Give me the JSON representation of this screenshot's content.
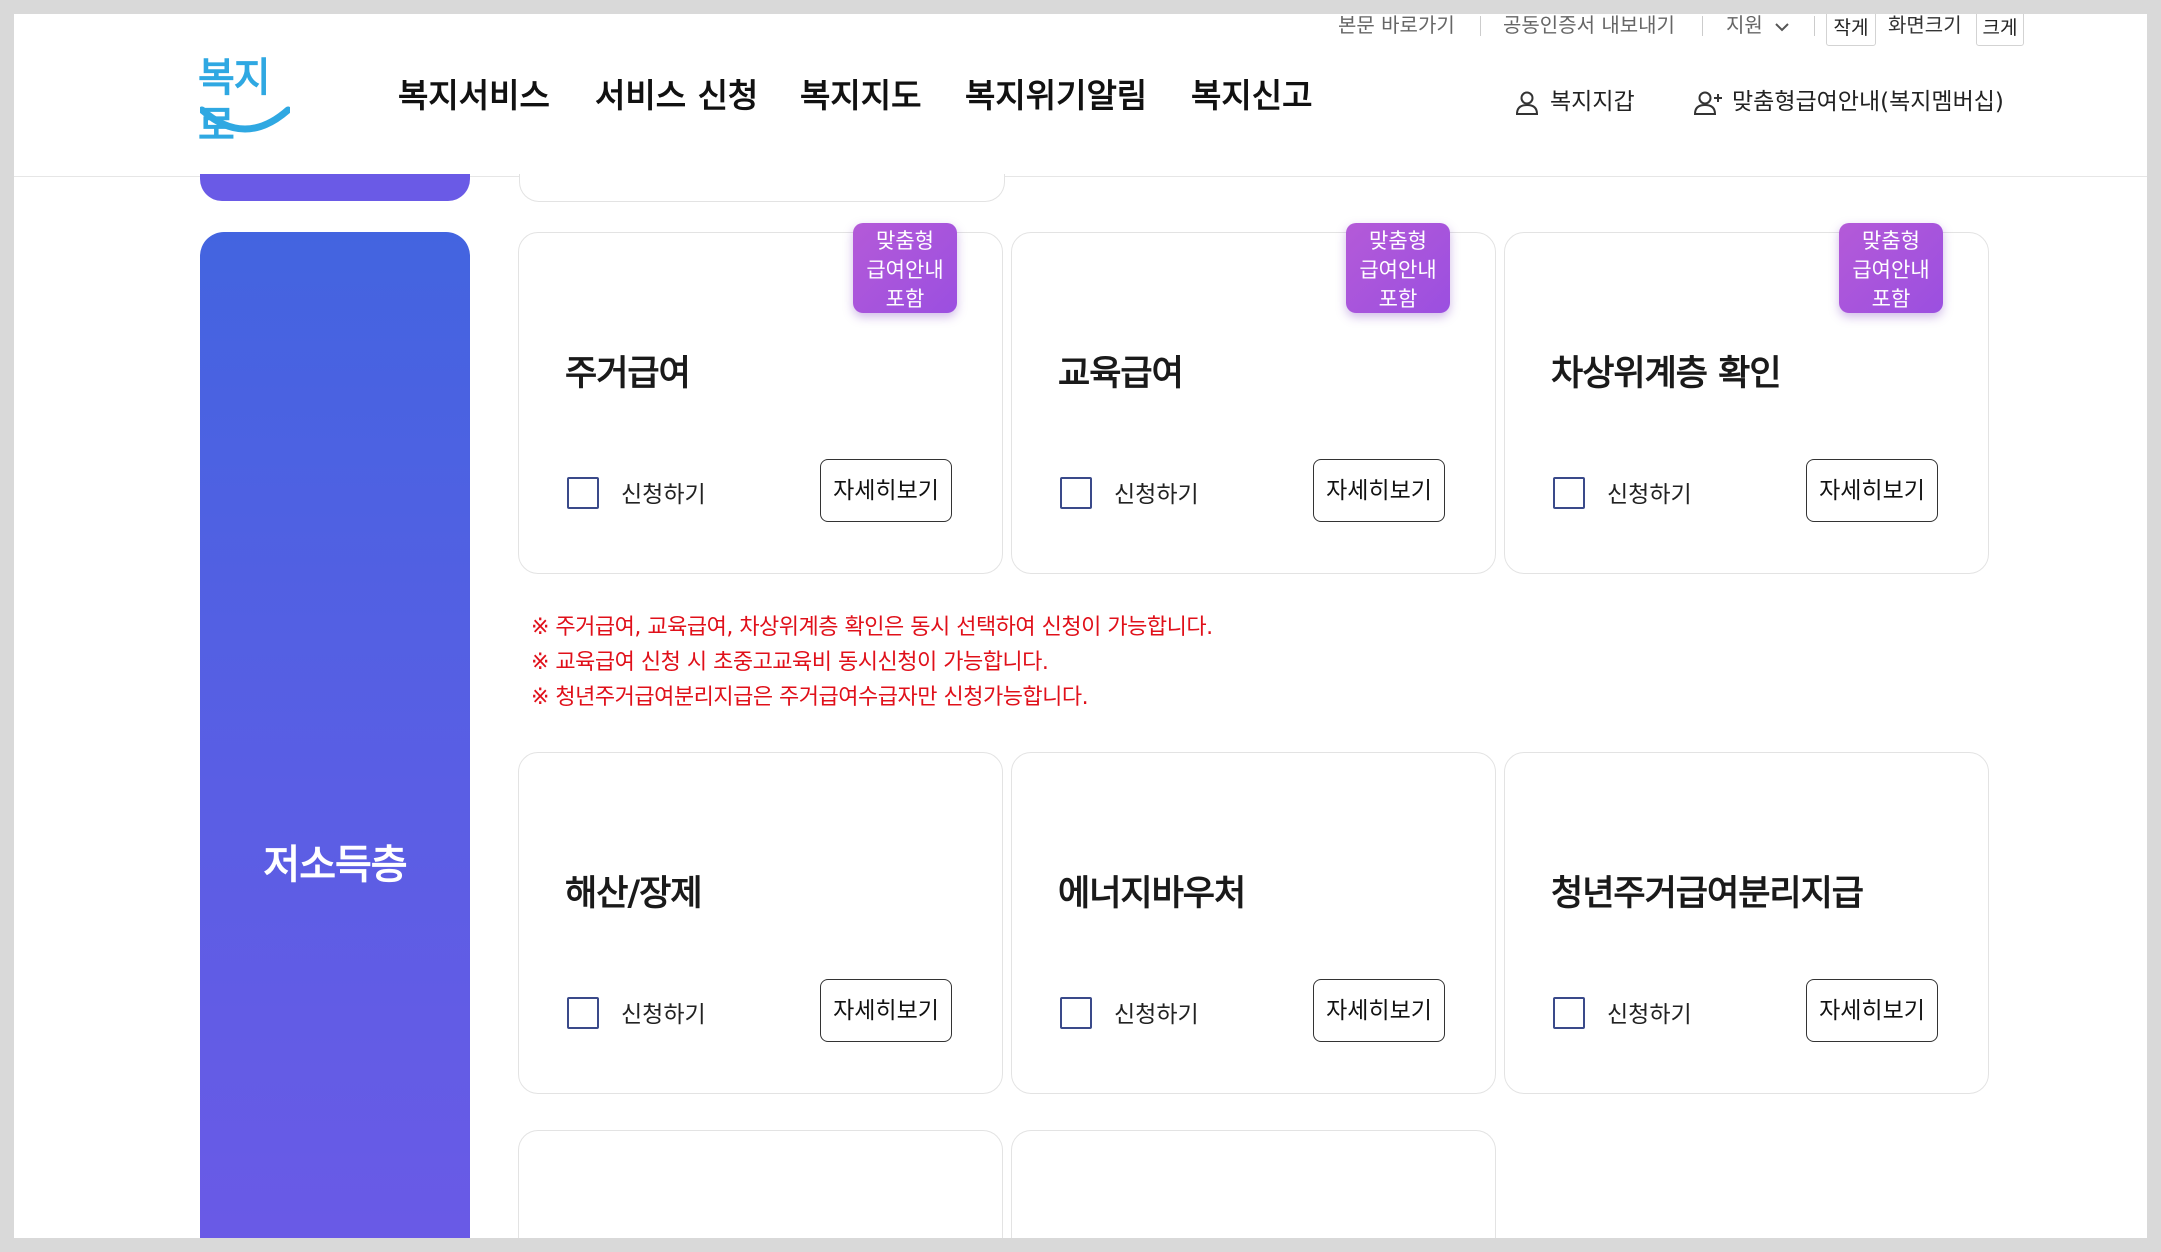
{
  "utility": {
    "skip_link": "본문 바로가기",
    "cert_export": "공동인증서 내보내기",
    "support": "지원",
    "font_small": "작게",
    "font_size_label": "화면크기",
    "font_large": "크게"
  },
  "logo": {
    "text": "복지로"
  },
  "gnb": {
    "items": [
      "복지서비스",
      "서비스 신청",
      "복지지도",
      "복지위기알림",
      "복지신고"
    ]
  },
  "member": {
    "wallet": "복지지갑",
    "membership": "맞춤형급여안내(복지멤버십)"
  },
  "category": {
    "title": "저소득층"
  },
  "badge": {
    "line1": "맞춤형",
    "line2": "급여안내",
    "line3": "포함"
  },
  "common": {
    "apply_label": "신청하기",
    "detail_label": "자세히보기"
  },
  "cards_row1": [
    {
      "title": "주거급여",
      "badge": true
    },
    {
      "title": "교육급여",
      "badge": true
    },
    {
      "title": "차상위계층 확인",
      "badge": true
    }
  ],
  "notices": [
    "※ 주거급여, 교육급여, 차상위계층 확인은 동시 선택하여 신청이 가능합니다.",
    "※ 교육급여 신청 시 초중고교육비 동시신청이 가능합니다.",
    "※ 청년주거급여분리지급은 주거급여수급자만 신청가능합니다."
  ],
  "cards_row2": [
    {
      "title": "해산/장제"
    },
    {
      "title": "에너지바우처"
    },
    {
      "title": "청년주거급여분리지급"
    }
  ],
  "colors": {
    "category_top": "#4364e0",
    "category_bottom": "#6a5ae6",
    "badge": "#a855dc",
    "notice": "#e0101a",
    "logo": "#2fa8e2"
  }
}
